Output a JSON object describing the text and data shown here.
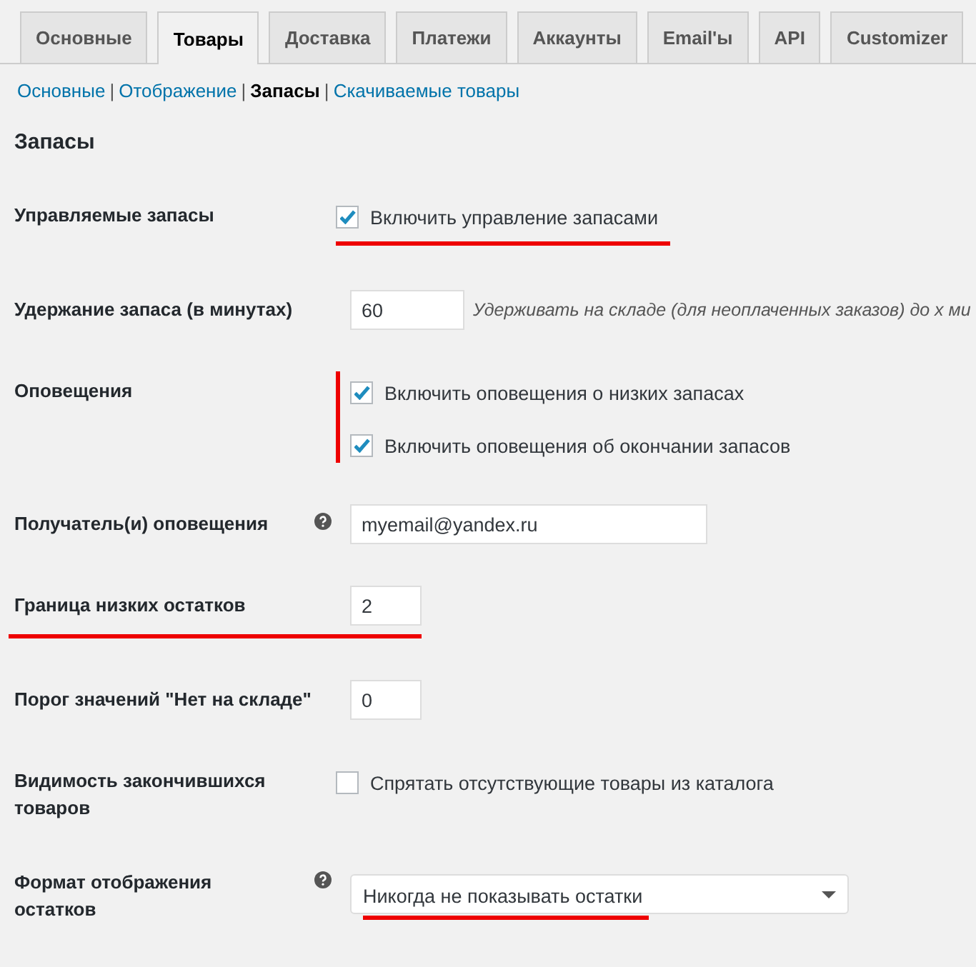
{
  "tabs": [
    {
      "label": "Основные",
      "selected": false
    },
    {
      "label": "Товары",
      "selected": true
    },
    {
      "label": "Доставка",
      "selected": false
    },
    {
      "label": "Платежи",
      "selected": false
    },
    {
      "label": "Аккаунты",
      "selected": false
    },
    {
      "label": "Email'ы",
      "selected": false
    },
    {
      "label": "API",
      "selected": false
    },
    {
      "label": "Customizer",
      "selected": false
    }
  ],
  "subnav": [
    {
      "label": "Основные",
      "selected": false
    },
    {
      "separator": "|",
      "label": "Отображение",
      "selected": false
    },
    {
      "separator": "|",
      "label": "Запасы",
      "selected": true
    },
    {
      "separator": "|",
      "label": "Скачиваемые товары",
      "selected": false
    }
  ],
  "heading": "Запасы",
  "rows": [
    {
      "kind": "checkbox",
      "label": "Управляемые запасы",
      "help": false,
      "annotation": {
        "kind": "control_underline"
      },
      "options": [
        {
          "label": "Включить управление запасами",
          "checked": true
        }
      ]
    },
    {
      "kind": "duration",
      "label": "Удержание запаса (в минутах)",
      "help": false,
      "value": "60",
      "description": "Удерживать на складе (для неоплаченных заказов) до х ми"
    },
    {
      "kind": "checkbox",
      "label": "Оповещения",
      "help": false,
      "annotation": {
        "kind": "side_bar"
      },
      "options": [
        {
          "label": "Включить оповещения о низких запасах",
          "checked": true
        },
        {
          "label": "Включить оповещения об окончании запасов",
          "checked": true
        }
      ]
    },
    {
      "kind": "text",
      "label": "Получатель(и) оповещения",
      "help": true,
      "value": "myemail@yandex.ru"
    },
    {
      "kind": "number",
      "label": "Граница низких остатков",
      "help": false,
      "annotation": {
        "kind": "row_underline"
      },
      "value": "2"
    },
    {
      "kind": "number",
      "label": "Порог значений \"Нет на складе\"",
      "help": false,
      "value": "0"
    },
    {
      "kind": "checkbox",
      "label": "Видимость закончившихся товаров",
      "help": false,
      "options": [
        {
          "label": "Спрятать отсутствующие товары из каталога",
          "checked": false
        }
      ]
    },
    {
      "kind": "select",
      "label": "Формат отображения остатков",
      "help": true,
      "annotation": {
        "kind": "value_underline"
      },
      "value": "Никогда не показывать остатки"
    }
  ]
}
